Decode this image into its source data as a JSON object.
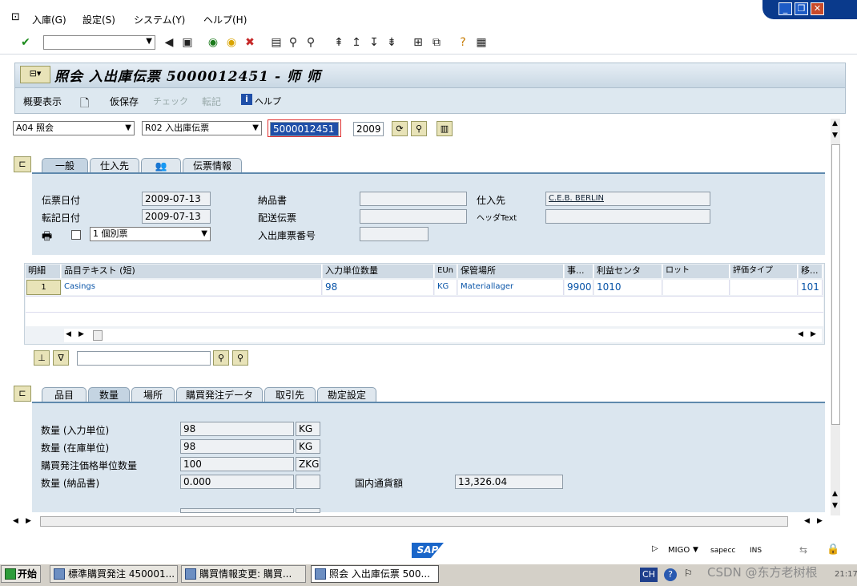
{
  "menu": {
    "item1": "入庫(G)",
    "item2": "設定(S)",
    "item3": "システム(Y)",
    "item4": "ヘルプ(H)"
  },
  "window_buttons": {
    "minimize": "_",
    "restore": "❐",
    "close": "✕"
  },
  "title": "照会 入出庫伝票 5000012451 - 师 师",
  "app_toolbar": {
    "overview": "概要表示",
    "hold": "仮保存",
    "check": "チェック",
    "post": "転記",
    "help": "ヘルプ"
  },
  "header": {
    "action": "A04 照会",
    "ref": "R02 入出庫伝票",
    "doc_number": "5000012451",
    "year": "2009"
  },
  "tabs_top": [
    "一般",
    "仕入先",
    "",
    "伝票情報"
  ],
  "general": {
    "doc_date_label": "伝票日付",
    "doc_date": "2009-07-13",
    "post_date_label": "転記日付",
    "post_date": "2009-07-13",
    "print_option": "1 個別票",
    "delivery_note_label": "納品書",
    "bill_of_lading_label": "配送伝票",
    "goods_receipt_slip_label": "入出庫票番号",
    "vendor_label": "仕入先",
    "vendor": "C.E.B. BERLIN",
    "header_text_label": "ヘッダText"
  },
  "table": {
    "headers": [
      "明細",
      "品目テキスト (短)",
      "入力単位数量",
      "EUn",
      "保管場所",
      "事...",
      "利益センタ",
      "ロット",
      "評価タイプ",
      "移..."
    ],
    "rows": [
      [
        "1",
        "Casings",
        "98",
        "KG",
        "Materiallager",
        "9900",
        "1010",
        "",
        "",
        "101"
      ]
    ]
  },
  "tabs_bottom": [
    "品目",
    "数量",
    "場所",
    "購買発注データ",
    "取引先",
    "勘定設定"
  ],
  "quantity": {
    "qty_entry_label": "数量 (入力単位)",
    "qty_entry": "98",
    "qty_entry_unit": "KG",
    "qty_sku_label": "数量 (在庫単位)",
    "qty_sku": "98",
    "qty_sku_unit": "KG",
    "qty_po_label": "購買発注価格単位数量",
    "qty_po": "100",
    "qty_po_unit": "ZKG",
    "qty_dn_label": "数量 (納品書)",
    "qty_dn": "0.000",
    "amount_lc_label": "国内通貨額",
    "amount_lc": "13,326.04"
  },
  "status": {
    "sap_logo": "SAP",
    "transaction": "MIGO",
    "system": "sapecc",
    "mode": "INS"
  },
  "taskbar": {
    "start": "开始",
    "tasks": [
      "標準購買発注 450001...",
      "購買情報変更: 購買...",
      "照会 入出庫伝票 500..."
    ],
    "lang": "CH",
    "watermark": "CSDN @东方老树根",
    "clock": "21:17"
  },
  "colors": {
    "accent": "#5f89ad",
    "panel": "#dbe6ef",
    "title_bar": "#c9d8e4"
  }
}
